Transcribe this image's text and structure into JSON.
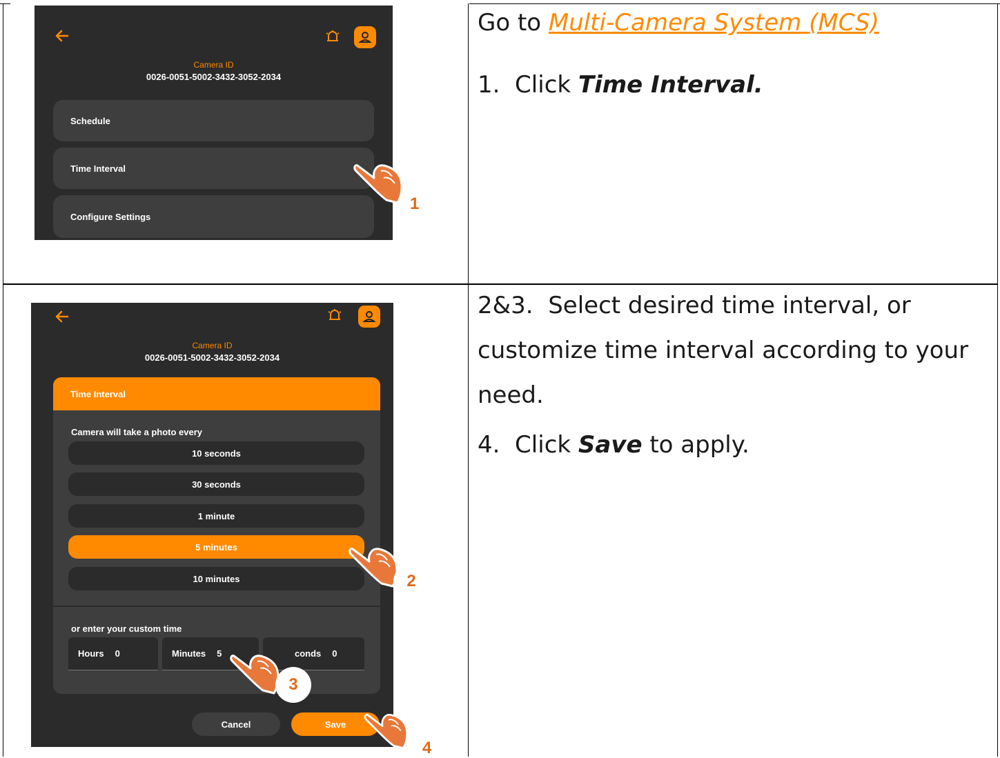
{
  "colors": {
    "accent": "#ff8a00",
    "screen_bg": "#2b2b2b",
    "card_bg": "#3e3e3e",
    "step_color": "#e06a1b"
  },
  "row1": {
    "screen": {
      "back_icon": "arrow-left-icon",
      "alarm_icon": "alarm-icon",
      "user_icon": "user-icon",
      "camera_label": "Camera ID",
      "camera_id": "0026-0051-5002-3432-3052-2034",
      "menu": [
        "Schedule",
        "Time Interval",
        "Configure Settings"
      ]
    },
    "step_marker": "1",
    "instructions": {
      "goto_prefix": "Go to ",
      "goto_link": "Multi-Camera System (MCS)",
      "step1_prefix": "1.  Click ",
      "step1_emph": "Time Interval."
    }
  },
  "row2": {
    "screen": {
      "back_icon": "arrow-left-icon",
      "alarm_icon": "alarm-icon",
      "user_icon": "user-icon",
      "camera_label": "Camera ID",
      "camera_id": "0026-0051-5002-3432-3052-2034",
      "panel_title": "Time Interval",
      "prompt": "Camera will take a photo every",
      "options": [
        "10 seconds",
        "30 seconds",
        "1 minute",
        "5 minutes",
        "10 minutes"
      ],
      "selected_option": "5 minutes",
      "custom_label": "or enter your custom time",
      "fields": [
        {
          "label": "Hours",
          "value": "0"
        },
        {
          "label": "Minutes",
          "value": "5"
        },
        {
          "label": "conds",
          "value": "0"
        }
      ],
      "cancel_label": "Cancel",
      "save_label": "Save"
    },
    "step_markers": [
      "2",
      "3",
      "4"
    ],
    "instructions": {
      "line1": "2&3.  Select desired time interval, or",
      "line2": "customize time interval according to your",
      "line3": "need.",
      "step4_prefix": "4.  Click ",
      "step4_emph": "Save",
      "step4_suffix": " to apply."
    }
  }
}
